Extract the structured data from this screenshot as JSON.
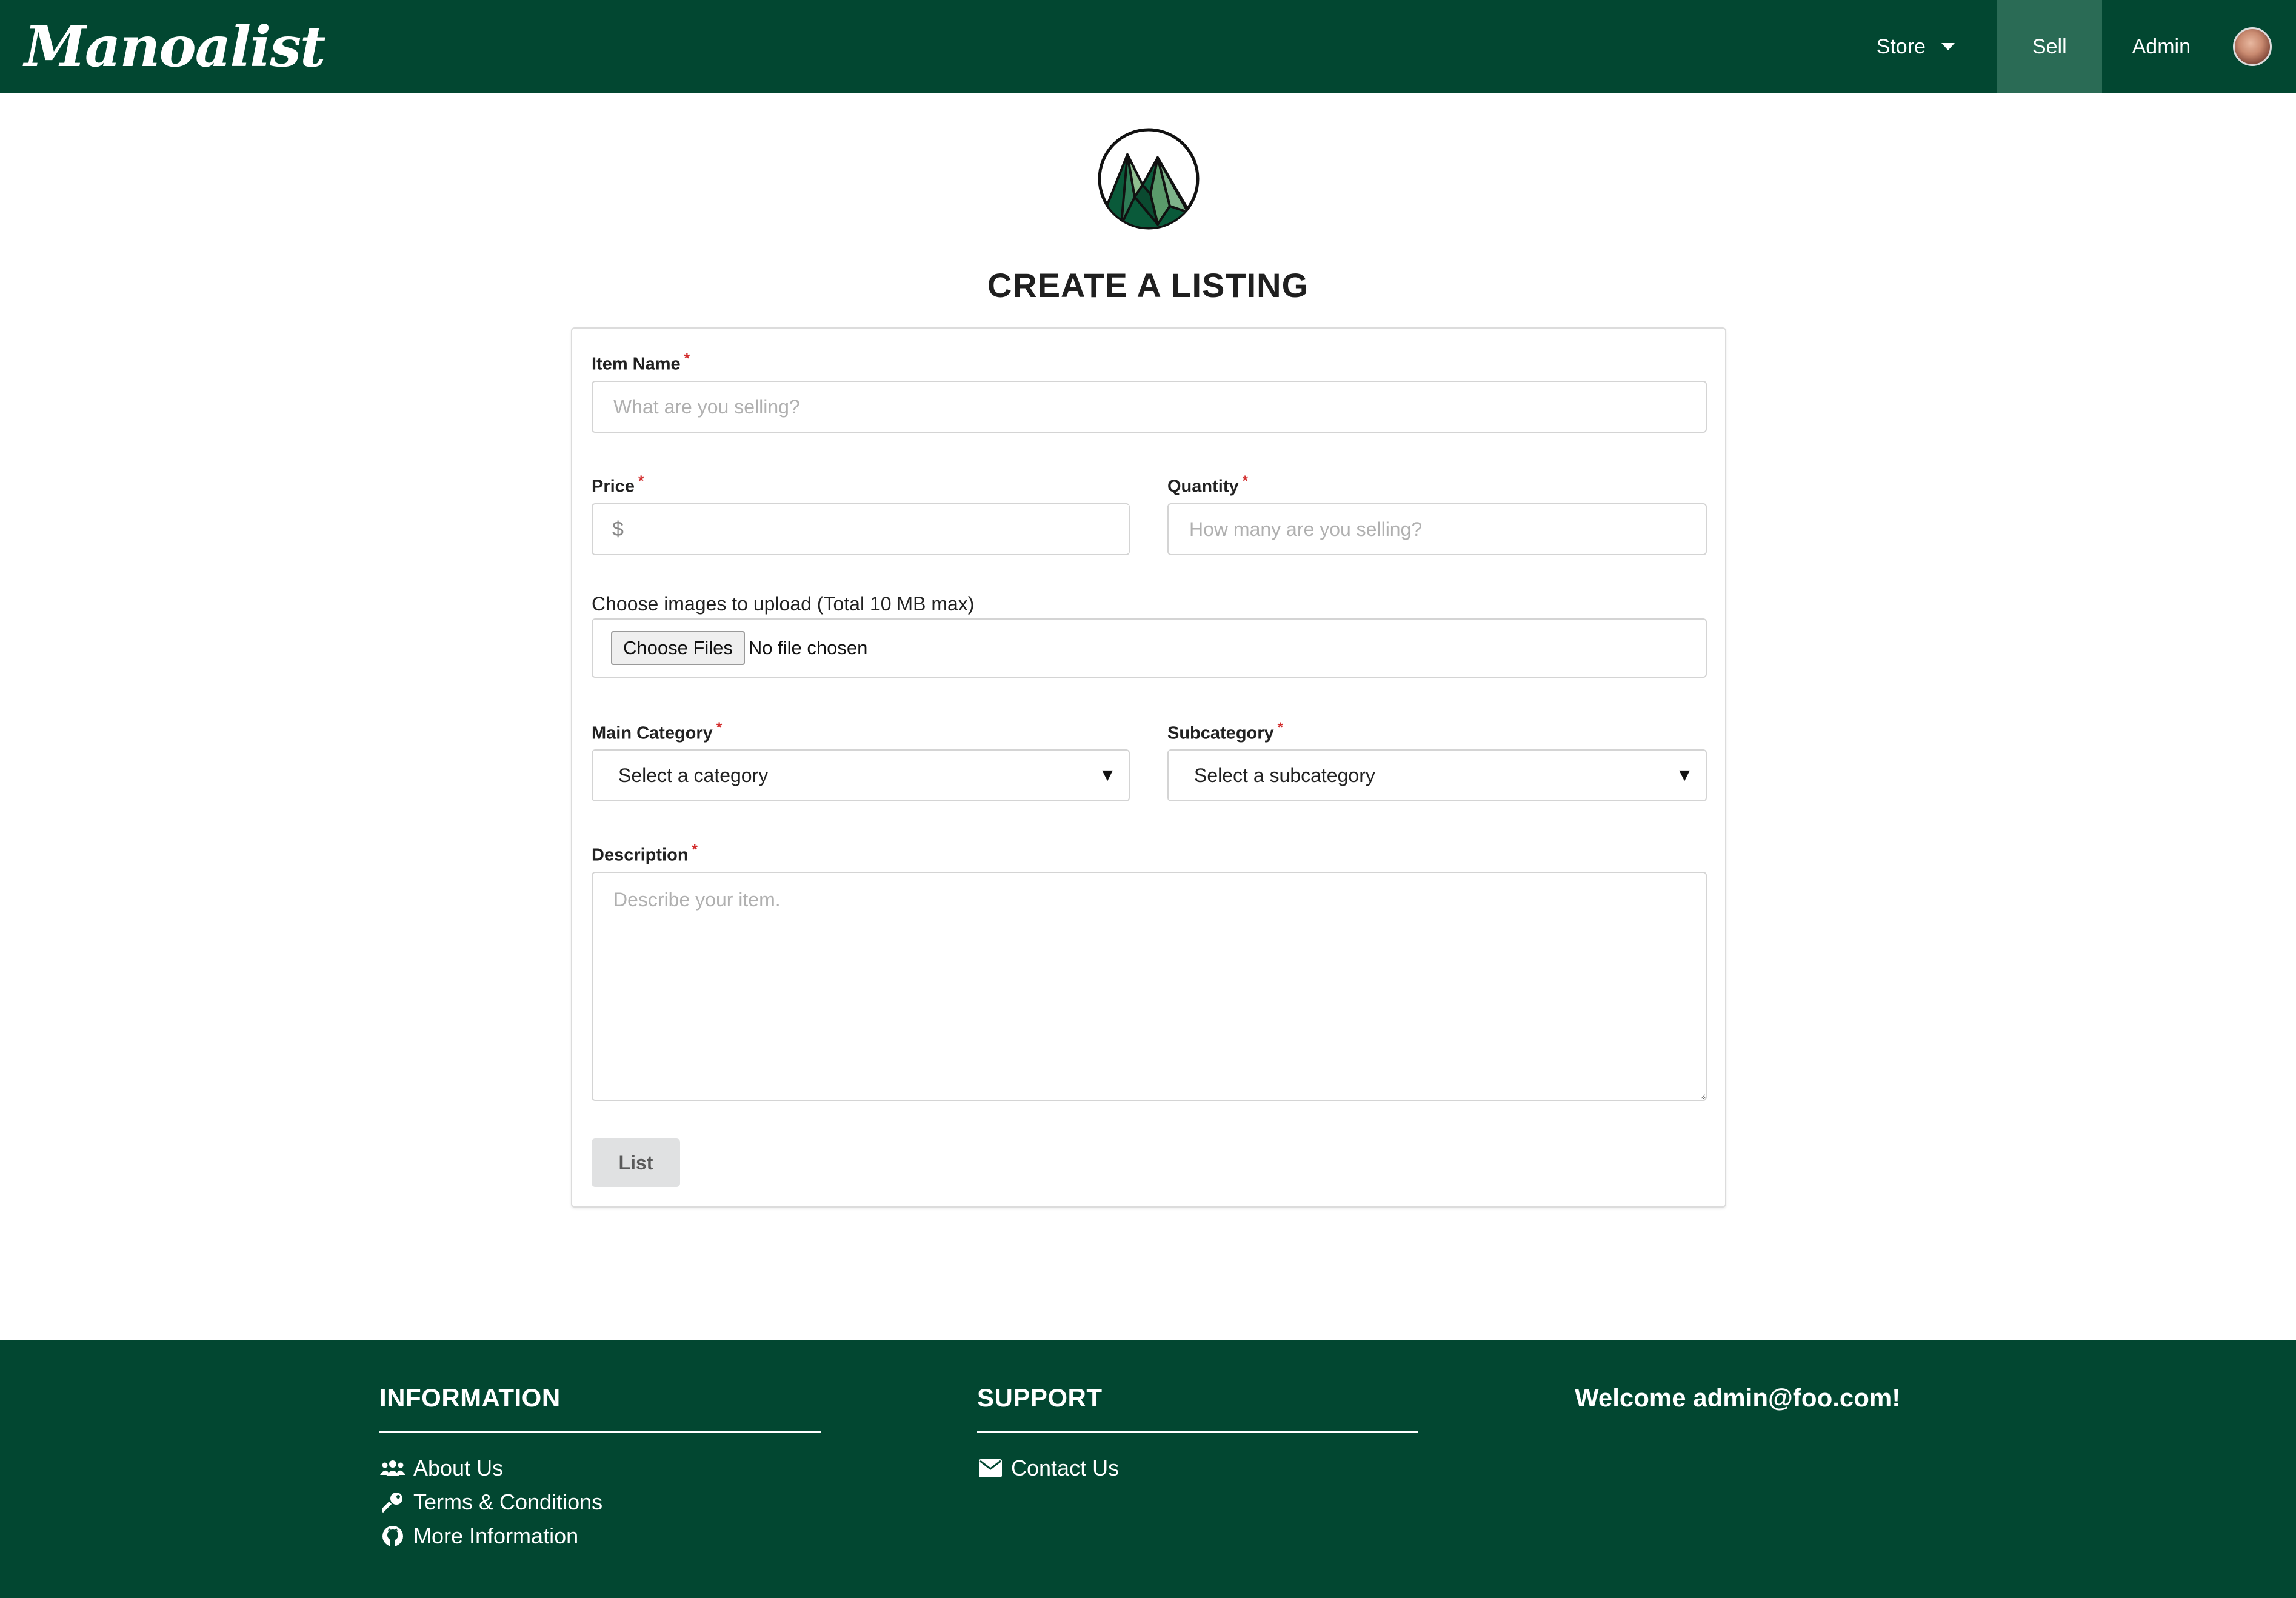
{
  "navbar": {
    "brand": "Manoalist",
    "store_label": "Store",
    "sell_label": "Sell",
    "admin_label": "Admin"
  },
  "page_title": "CREATE A LISTING",
  "form": {
    "item_name": {
      "label": "Item Name",
      "required": "*",
      "placeholder": "What are you selling?"
    },
    "price": {
      "label": "Price",
      "required": "*",
      "prefix": "$"
    },
    "quantity": {
      "label": "Quantity",
      "required": "*",
      "placeholder": "How many are you selling?"
    },
    "images": {
      "label": "Choose images to upload (Total 10 MB max)",
      "button_label": "Choose Files",
      "status": "No file chosen"
    },
    "main_category": {
      "label": "Main Category",
      "required": "*",
      "selected": "Select a category"
    },
    "subcategory": {
      "label": "Subcategory",
      "required": "*",
      "selected": "Select a subcategory"
    },
    "description": {
      "label": "Description",
      "required": "*",
      "placeholder": "Describe your item."
    },
    "submit_label": "List"
  },
  "footer": {
    "information": {
      "heading": "INFORMATION",
      "links": [
        {
          "label": "About Us",
          "icon": "users-icon"
        },
        {
          "label": "Terms & Conditions",
          "icon": "key-icon"
        },
        {
          "label": "More Information",
          "icon": "github-icon"
        }
      ]
    },
    "support": {
      "heading": "SUPPORT",
      "links": [
        {
          "label": "Contact Us",
          "icon": "envelope-icon"
        }
      ]
    },
    "welcome": "Welcome admin@foo.com!"
  },
  "colors": {
    "primary": "#024731",
    "active_nav": "#2a6b55",
    "required": "#d32f2f"
  }
}
